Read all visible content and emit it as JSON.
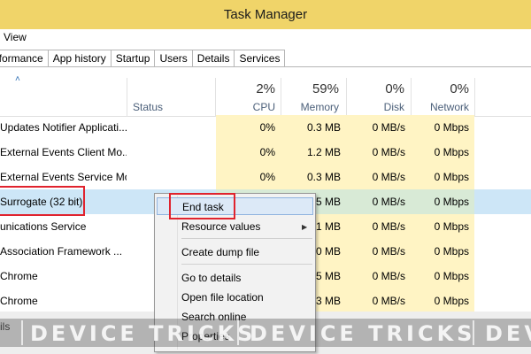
{
  "window": {
    "title": "Task Manager"
  },
  "menu": {
    "view": "View"
  },
  "tabs": [
    "Performance",
    "App history",
    "Startup",
    "Users",
    "Details",
    "Services"
  ],
  "header": {
    "sort_arrow": "˄",
    "status": "Status",
    "cpu": {
      "pct": "2%",
      "label": "CPU"
    },
    "memory": {
      "pct": "59%",
      "label": "Memory"
    },
    "disk": {
      "pct": "0%",
      "label": "Disk"
    },
    "network": {
      "pct": "0%",
      "label": "Network"
    }
  },
  "rows": [
    {
      "name": "Updates Notifier Applicati...",
      "cpu": "0%",
      "memory": "0.3 MB",
      "disk": "0 MB/s",
      "network": "0 Mbps"
    },
    {
      "name": "External Events Client Mo...",
      "cpu": "0%",
      "memory": "1.2 MB",
      "disk": "0 MB/s",
      "network": "0 Mbps"
    },
    {
      "name": "External Events Service Mo...",
      "cpu": "0%",
      "memory": "0.3 MB",
      "disk": "0 MB/s",
      "network": "0 Mbps"
    },
    {
      "name": "Surrogate (32 bit)",
      "cpu": "",
      "memory": "5 MB",
      "disk": "0 MB/s",
      "network": "0 Mbps"
    },
    {
      "name": "unications Service",
      "cpu": "",
      "memory": "1 MB",
      "disk": "0 MB/s",
      "network": "0 Mbps"
    },
    {
      "name": "Association Framework ...",
      "cpu": "",
      "memory": "0 MB",
      "disk": "0 MB/s",
      "network": "0 Mbps"
    },
    {
      "name": "Chrome",
      "cpu": "",
      "memory": "5 MB",
      "disk": "0 MB/s",
      "network": "0 Mbps"
    },
    {
      "name": "Chrome",
      "cpu": "",
      "memory": "3 MB",
      "disk": "0 MB/s",
      "network": "0 Mbps"
    }
  ],
  "context_menu": {
    "end_task": "End task",
    "resource_values": "Resource values",
    "create_dump_file": "Create dump file",
    "go_to_details": "Go to details",
    "open_file_location": "Open file location",
    "search_online": "Search online",
    "properties": "Properties",
    "submenu_arrow": "▶"
  },
  "footer": {
    "text": "ils"
  },
  "watermark": {
    "text": "DEVICE TRICKS"
  },
  "colors": {
    "titlebar": "#f0d469",
    "heat": "#fff4c4",
    "selected": "#cde6f7",
    "highlight_box": "#e0232e"
  }
}
